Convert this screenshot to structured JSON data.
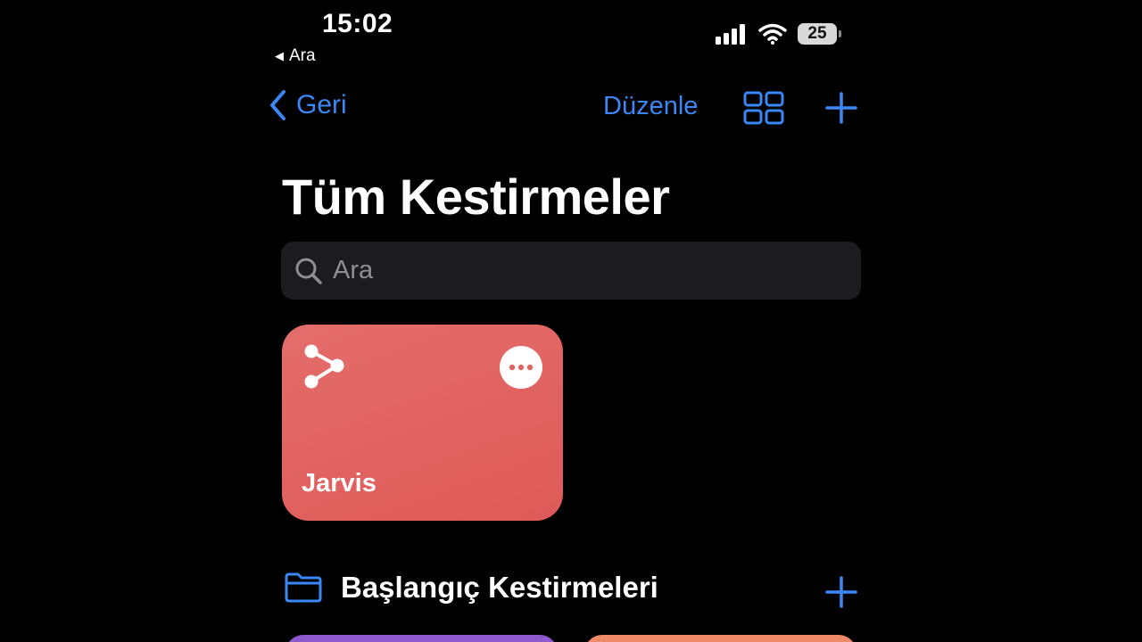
{
  "status_bar": {
    "time": "15:02",
    "back_app": "Ara",
    "battery": "25",
    "icons": [
      "cellular-signal-icon",
      "wifi-icon",
      "battery-icon"
    ]
  },
  "nav": {
    "back_label": "Geri",
    "edit_label": "Düzenle",
    "icons": [
      "chevron-left-icon",
      "grid-view-icon",
      "plus-icon"
    ]
  },
  "page": {
    "title": "Tüm Kestirmeler"
  },
  "search": {
    "placeholder": "Ara"
  },
  "shortcuts": [
    {
      "name": "Jarvis",
      "color": "#e16563",
      "icon": "share-icon",
      "menu_icon": "ellipsis-icon"
    }
  ],
  "folder": {
    "label": "Başlangıç Kestirmeleri",
    "icon": "folder-icon"
  },
  "next_shortcuts": [
    {
      "color": "#8e59cc"
    },
    {
      "color": "#ee8a67"
    }
  ],
  "colors": {
    "accent": "#3c87f7",
    "background": "#000000",
    "search_bg": "#1c1c1e"
  }
}
